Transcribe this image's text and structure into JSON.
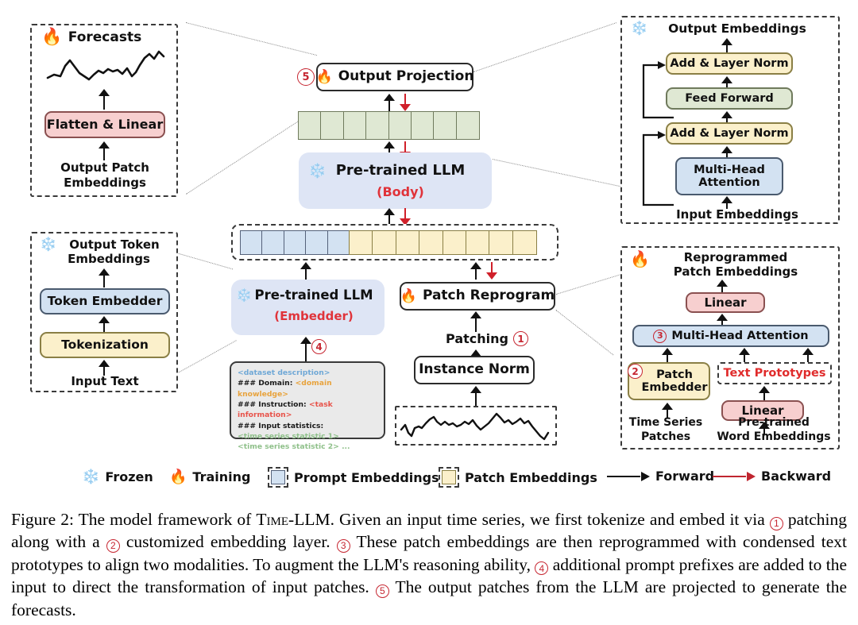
{
  "figure": {
    "number": "Figure 2",
    "caption_parts": [
      "Figure 2:",
      " The model framework of ",
      "Time-LLM",
      ". Given an input time series, we first tokenize and embed it via ",
      "1",
      " patching along with a ",
      "2",
      " customized embedding layer. ",
      "3",
      " These patch embeddings are then reprogrammed with condensed text prototypes to align two modalities. To augment the LLM's reasoning ability, ",
      "4",
      " additional prompt prefixes are added to the input to direct the transformation of input patches. ",
      "5",
      " The output patches from the LLM are projected to generate the forecasts."
    ]
  },
  "colors": {
    "yellow": "#FBF0CB",
    "green": "#DFE8D3",
    "blue": "#D3E2F2",
    "pink": "#F7CFCF",
    "lavender": "#DEE5F5",
    "red_accent": "#d0202a",
    "circle_red": "#c62631",
    "gray_prompt_bg": "#EAEAEA"
  },
  "panel_forecast": {
    "title": "Forecasts",
    "flatten_linear": "Flatten & Linear",
    "input_label_line1": "Output Patch",
    "input_label_line2": "Embeddings",
    "icon": "fire-icon"
  },
  "panel_token_embedding": {
    "title_line1": "Output Token",
    "title_line2": "Embeddings",
    "token_embedder": "Token Embedder",
    "tokenization": "Tokenization",
    "input_text": "Input Text",
    "icon": "snowflake-icon"
  },
  "panel_transformer": {
    "title": "Output Embeddings",
    "add_norm_top": "Add & Layer Norm",
    "feed_forward": "Feed Forward",
    "add_norm_bottom": "Add & Layer Norm",
    "attention_line1": "Multi-Head",
    "attention_line2": "Attention",
    "input_label": "Input Embeddings",
    "icon": "snowflake-icon"
  },
  "panel_reprogram": {
    "title_line1": "Reprogrammed",
    "title_line2": "Patch Embeddings",
    "linear_top": "Linear",
    "attention": "Multi-Head Attention",
    "attention_num": "3",
    "patch_embedder_line1": "Patch",
    "patch_embedder_line2": "Embedder",
    "patch_embedder_num": "2",
    "text_prototypes": "Text Prototypes",
    "linear_bottom": "Linear",
    "time_series_line1": "Time Series",
    "time_series_line2": "Patches",
    "word_emb_line1": "Pre-trained",
    "word_emb_line2": "Word Embeddings",
    "icon": "fire-icon"
  },
  "main_flow": {
    "output_projection": "Output Projection",
    "output_projection_num": "5",
    "llm_body_title": "Pre-trained LLM",
    "llm_body_sub": "(Body)",
    "llm_embedder_title": "Pre-trained LLM",
    "llm_embedder_sub": "(Embedder)",
    "llm_embedder_num": "4",
    "patch_reprogram": "Patch Reprogram",
    "patching_label": "Patching",
    "patching_num": "1",
    "instance_norm": "Instance Norm",
    "green_cells": 8,
    "prompt_cells": 5,
    "patch_cells": 8
  },
  "prompt_box": {
    "line1": "<dataset description>",
    "line2_key": "### Domain:",
    "line2_val": "<domain knowledge>",
    "line3_key": "### Instruction:",
    "line3_val": "<task information>",
    "line4_key": "### Input statistics:",
    "line5": "<time series statistic 1>",
    "line6": "<time series statistic 2>  ..."
  },
  "legend": {
    "frozen": "Frozen",
    "training": "Training",
    "prompt_embeddings": "Prompt Embeddings",
    "patch_embeddings": "Patch Embeddings",
    "forward": "Forward",
    "backward": "Backward"
  }
}
